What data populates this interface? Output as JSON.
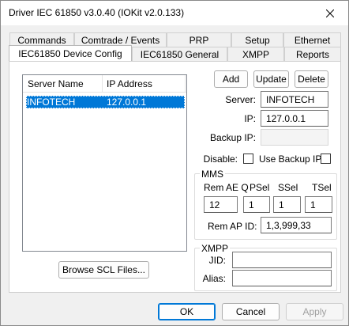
{
  "window": {
    "title": "Driver IEC 61850 v3.0.40 (IOKit v2.0.133)"
  },
  "tabs": {
    "row_back": [
      "Commands",
      "Comtrade / Events",
      "PRP",
      "Setup",
      "Ethernet"
    ],
    "row_front": [
      "IEC61850 Device Config",
      "IEC61850 General",
      "XMPP",
      "Reports"
    ],
    "active": "IEC61850 Device Config"
  },
  "server_list": {
    "columns": [
      "Server Name",
      "IP Address"
    ],
    "rows": [
      {
        "name": "INFOTECH",
        "ip": "127.0.0.1",
        "selected": true
      }
    ]
  },
  "actions": {
    "add": "Add",
    "update": "Update",
    "delete": "Delete",
    "browse": "Browse SCL Files..."
  },
  "server_form": {
    "server_label": "Server:",
    "server_value": "INFOTECH",
    "ip_label": "IP:",
    "ip_value": "127.0.0.1",
    "backup_ip_label": "Backup IP:",
    "backup_ip_value": "",
    "disable_label": "Disable:",
    "disable_checked": false,
    "use_backup_label": "Use Backup IP:",
    "use_backup_checked": false
  },
  "mms": {
    "title": "MMS",
    "rem_ae_q_label": "Rem AE Q",
    "psel_label": "PSel",
    "ssel_label": "SSel",
    "tsel_label": "TSel",
    "rem_ae_q_value": "12",
    "psel_value": "1",
    "ssel_value": "1",
    "tsel_value": "1",
    "rem_ap_id_label": "Rem AP ID:",
    "rem_ap_id_value": "1,3,999,33"
  },
  "xmpp": {
    "title": "XMPP",
    "jid_label": "JID:",
    "jid_value": "",
    "alias_label": "Alias:",
    "alias_value": ""
  },
  "footer": {
    "ok": "OK",
    "cancel": "Cancel",
    "apply": "Apply"
  },
  "colors": {
    "selection": "#0078d7",
    "dialog_bg": "#f0f0f0"
  }
}
